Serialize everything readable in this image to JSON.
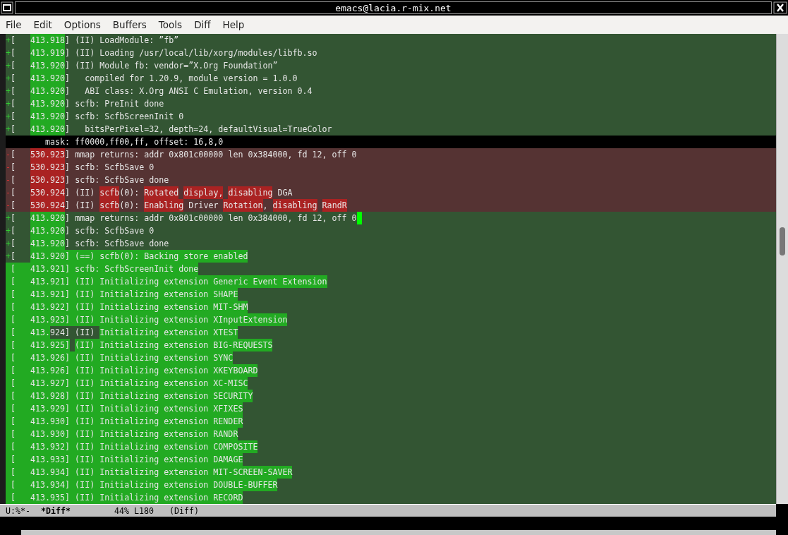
{
  "window": {
    "title": "emacs@lacia.r-mix.net"
  },
  "menu": [
    "File",
    "Edit",
    "Options",
    "Buffers",
    "Tools",
    "Diff",
    "Help"
  ],
  "lines": [
    {
      "kind": "added",
      "marker": "+",
      "cursor": false,
      "segments": [
        {
          "text": "[   ",
          "hl": false
        },
        {
          "text": "413.918",
          "hl": true
        },
        {
          "text": "] (II) LoadModule: ”fb”",
          "hl": false
        }
      ]
    },
    {
      "kind": "added",
      "marker": "+",
      "cursor": false,
      "segments": [
        {
          "text": "[   ",
          "hl": false
        },
        {
          "text": "413.919",
          "hl": true
        },
        {
          "text": "] (II) Loading /usr/local/lib/xorg/modules/libfb.so",
          "hl": false
        }
      ]
    },
    {
      "kind": "added",
      "marker": "+",
      "cursor": false,
      "segments": [
        {
          "text": "[   ",
          "hl": false
        },
        {
          "text": "413.920",
          "hl": true
        },
        {
          "text": "] (II) Module fb: vendor=”X.Org Foundation”",
          "hl": false
        }
      ]
    },
    {
      "kind": "added",
      "marker": "+",
      "cursor": false,
      "segments": [
        {
          "text": "[   ",
          "hl": false
        },
        {
          "text": "413.920",
          "hl": true
        },
        {
          "text": "]   compiled for 1.20.9, module version = 1.0.0",
          "hl": false
        }
      ]
    },
    {
      "kind": "added",
      "marker": "+",
      "cursor": false,
      "segments": [
        {
          "text": "[   ",
          "hl": false
        },
        {
          "text": "413.920",
          "hl": true
        },
        {
          "text": "]   ABI class: X.Org ANSI C Emulation, version 0.4",
          "hl": false
        }
      ]
    },
    {
      "kind": "added",
      "marker": "+",
      "cursor": false,
      "segments": [
        {
          "text": "[   ",
          "hl": false
        },
        {
          "text": "413.920",
          "hl": true
        },
        {
          "text": "] scfb: PreInit done",
          "hl": false
        }
      ]
    },
    {
      "kind": "added",
      "marker": "+",
      "cursor": false,
      "segments": [
        {
          "text": "[   ",
          "hl": false
        },
        {
          "text": "413.920",
          "hl": true
        },
        {
          "text": "] scfb: ScfbScreenInit 0",
          "hl": false
        }
      ]
    },
    {
      "kind": "added",
      "marker": "+",
      "cursor": false,
      "segments": [
        {
          "text": "[   ",
          "hl": false
        },
        {
          "text": "413.920",
          "hl": true
        },
        {
          "text": "]   bitsPerPixel=32, depth=24, defaultVisual=TrueColor",
          "hl": false
        }
      ]
    },
    {
      "kind": "context",
      "cursor": false,
      "segments": [
        {
          "text": "        mask: ff0000,ff00,ff, offset: 16,8,0",
          "hl": false
        }
      ]
    },
    {
      "kind": "removed",
      "marker": "-",
      "cursor": false,
      "segments": [
        {
          "text": "[   ",
          "hl": false
        },
        {
          "text": "530.923",
          "hl": true
        },
        {
          "text": "] mmap returns: addr 0x801c00000 len 0x384000, fd 12, off 0",
          "hl": false
        }
      ]
    },
    {
      "kind": "removed",
      "marker": "-",
      "cursor": false,
      "segments": [
        {
          "text": "[   ",
          "hl": false
        },
        {
          "text": "530.923",
          "hl": true
        },
        {
          "text": "] scfb: ScfbSave 0",
          "hl": false
        }
      ]
    },
    {
      "kind": "removed",
      "marker": "-",
      "cursor": false,
      "segments": [
        {
          "text": "[   ",
          "hl": false
        },
        {
          "text": "530.923",
          "hl": true
        },
        {
          "text": "] scfb: ScfbSave done",
          "hl": false
        }
      ]
    },
    {
      "kind": "removed",
      "marker": "-",
      "cursor": false,
      "segments": [
        {
          "text": "[   ",
          "hl": false
        },
        {
          "text": "530.924",
          "hl": true
        },
        {
          "text": "] (II) ",
          "hl": false
        },
        {
          "text": "scfb",
          "hl": true
        },
        {
          "text": "(0): ",
          "hl": false
        },
        {
          "text": "Rotated",
          "hl": true,
          "space_after": true
        },
        {
          "text": "display,",
          "hl": true,
          "space_after": true
        },
        {
          "text": "disabling",
          "hl": true
        },
        {
          "text": " DGA",
          "hl": false
        }
      ]
    },
    {
      "kind": "removed",
      "marker": "-",
      "cursor": false,
      "segments": [
        {
          "text": "[   ",
          "hl": false
        },
        {
          "text": "530.924",
          "hl": true
        },
        {
          "text": "] (II) ",
          "hl": false
        },
        {
          "text": "scfb",
          "hl": true
        },
        {
          "text": "(0): ",
          "hl": false
        },
        {
          "text": "Enabling",
          "hl": true
        },
        {
          "text": " Driver ",
          "hl": false
        },
        {
          "text": "Rotation",
          "hl": true
        },
        {
          "text": ", ",
          "hl": false
        },
        {
          "text": "disabling",
          "hl": true,
          "space_after": true
        },
        {
          "text": "RandR",
          "hl": true
        }
      ]
    },
    {
      "kind": "added",
      "marker": "+",
      "cursor": true,
      "segments": [
        {
          "text": "[   ",
          "hl": false
        },
        {
          "text": "413.920",
          "hl": true
        },
        {
          "text": "] mmap returns: addr 0x801c00000 len 0x384000, fd 12, off 0",
          "hl": false
        }
      ]
    },
    {
      "kind": "added",
      "marker": "+",
      "cursor": false,
      "segments": [
        {
          "text": "[   ",
          "hl": false
        },
        {
          "text": "413.920",
          "hl": true
        },
        {
          "text": "] scfb: ScfbSave 0",
          "hl": false
        }
      ]
    },
    {
      "kind": "added",
      "marker": "+",
      "cursor": false,
      "segments": [
        {
          "text": "[   ",
          "hl": false
        },
        {
          "text": "413.920",
          "hl": true
        },
        {
          "text": "] scfb: ScfbSave done",
          "hl": false
        }
      ]
    },
    {
      "kind": "added",
      "marker": "+",
      "cursor": false,
      "segments": [
        {
          "text": "[   ",
          "hl": false
        },
        {
          "text": "413.920] (==) scfb(0): Backing store enabled",
          "hl": true
        }
      ]
    },
    {
      "kind": "added",
      "cursor": false,
      "segments": [
        {
          "text": " [   413.921] scfb: ScfbScreenInit done",
          "hl": true
        }
      ]
    },
    {
      "kind": "added",
      "cursor": false,
      "segments": [
        {
          "text": " [   413.921] (II) Initializing extension Generic Event Extension",
          "hl": true
        }
      ]
    },
    {
      "kind": "added",
      "cursor": false,
      "segments": [
        {
          "text": " [   413.921] (II) Initializing extension SHAPE",
          "hl": true
        }
      ]
    },
    {
      "kind": "added",
      "cursor": false,
      "segments": [
        {
          "text": " [   413.922] (II) Initializing extension MIT-SHM",
          "hl": true
        }
      ]
    },
    {
      "kind": "added",
      "cursor": false,
      "segments": [
        {
          "text": " [   413.923] (II) Initializing extension XInputExtension",
          "hl": true
        }
      ]
    },
    {
      "kind": "added",
      "cursor": false,
      "segments": [
        {
          "text": " [   413.",
          "hl": true
        },
        {
          "text": "924] (II) ",
          "hl": false
        },
        {
          "text": "Initializing extension XTEST",
          "hl": true
        }
      ]
    },
    {
      "kind": "added",
      "cursor": false,
      "segments": [
        {
          "text": " [   413.925]",
          "hl": true,
          "space_after": true
        },
        {
          "text": "(II) Initializing extension BIG-REQUESTS",
          "hl": true
        }
      ]
    },
    {
      "kind": "added",
      "cursor": false,
      "segments": [
        {
          "text": " [   413.926] (II) Initializing extension SYNC",
          "hl": true
        }
      ]
    },
    {
      "kind": "added",
      "cursor": false,
      "segments": [
        {
          "text": " [   413.926] (II) Initializing extension XKEYBOARD",
          "hl": true
        }
      ]
    },
    {
      "kind": "added",
      "cursor": false,
      "segments": [
        {
          "text": " [   413.927] (II) Initializing extension XC-MISC",
          "hl": true
        }
      ]
    },
    {
      "kind": "added",
      "cursor": false,
      "segments": [
        {
          "text": " [   413.928] (II) Initializing extension SECURITY",
          "hl": true
        }
      ]
    },
    {
      "kind": "added",
      "cursor": false,
      "segments": [
        {
          "text": " [   413.929] (II) Initializing extension XFIXES",
          "hl": true
        }
      ]
    },
    {
      "kind": "added",
      "cursor": false,
      "segments": [
        {
          "text": " [   413.930] (II) Initializing extension RENDER",
          "hl": true
        }
      ]
    },
    {
      "kind": "added",
      "cursor": false,
      "segments": [
        {
          "text": " [   413.930] (II) Initializing extension RANDR",
          "hl": true
        }
      ]
    },
    {
      "kind": "added",
      "cursor": false,
      "segments": [
        {
          "text": " [   413.932] (II) Initializing extension COMPOSITE",
          "hl": true
        }
      ]
    },
    {
      "kind": "added",
      "cursor": false,
      "segments": [
        {
          "text": " [   413.933] (II) Initializing extension DAMAGE",
          "hl": true
        }
      ]
    },
    {
      "kind": "added",
      "cursor": false,
      "segments": [
        {
          "text": " [   413.934] (II) Initializing extension MIT-SCREEN-SAVER",
          "hl": true
        }
      ]
    },
    {
      "kind": "added",
      "cursor": false,
      "segments": [
        {
          "text": " [   413.934] (II) Initializing extension DOUBLE-BUFFER",
          "hl": true
        }
      ]
    },
    {
      "kind": "added",
      "cursor": false,
      "segments": [
        {
          "text": " [   413.935] (II) Initializing extension RECORD",
          "hl": true
        }
      ]
    }
  ],
  "mode_line": {
    "status": "U:%*-",
    "buffer": "*Diff*",
    "position": "44% L180",
    "mode": "(Diff)"
  }
}
